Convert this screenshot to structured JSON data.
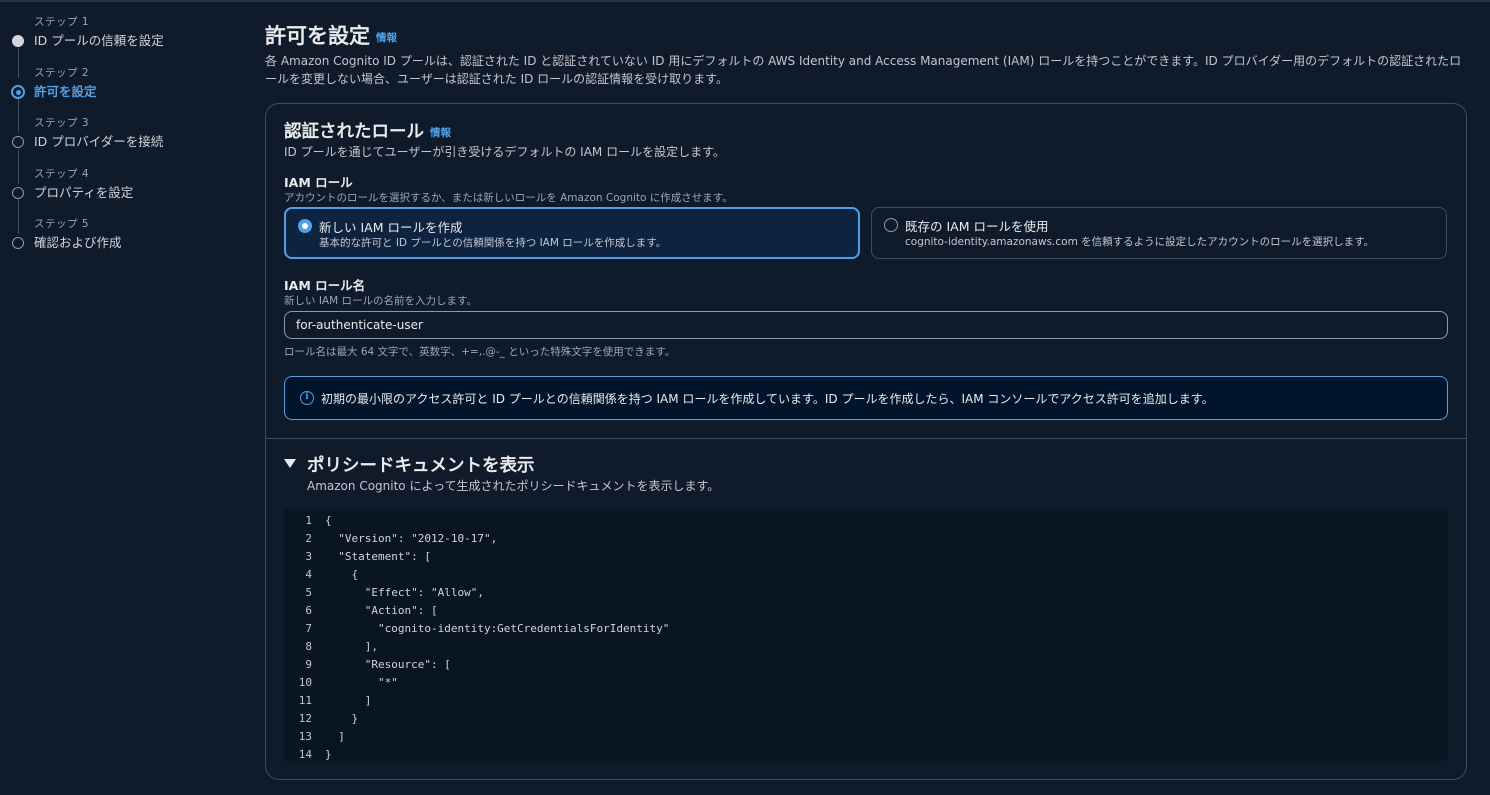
{
  "sidebar": {
    "steps": [
      {
        "label": "ステップ 1",
        "title": "ID プールの信頼を設定",
        "state": "completed"
      },
      {
        "label": "ステップ 2",
        "title": "許可を設定",
        "state": "active"
      },
      {
        "label": "ステップ 3",
        "title": "ID プロバイダーを接続",
        "state": "pending"
      },
      {
        "label": "ステップ 4",
        "title": "プロパティを設定",
        "state": "pending"
      },
      {
        "label": "ステップ 5",
        "title": "確認および作成",
        "state": "pending"
      }
    ]
  },
  "header": {
    "title": "許可を設定",
    "info": "情報",
    "description": "各 Amazon Cognito ID プールは、認証された ID と認証されていない ID 用にデフォルトの AWS Identity and Access Management (IAM) ロールを持つことができます。ID プロバイダー用のデフォルトの認証されたロールを変更しない場合、ユーザーは認証された ID ロールの認証情報を受け取ります。"
  },
  "auth_role": {
    "title": "認証されたロール",
    "info": "情報",
    "description": "ID プールを通じてユーザーが引き受けるデフォルトの IAM ロールを設定します。",
    "iam_role_label": "IAM ロール",
    "iam_role_desc": "アカウントのロールを選択するか、または新しいロールを Amazon Cognito に作成させます。",
    "options": [
      {
        "title": "新しい IAM ロールを作成",
        "desc": "基本的な許可と ID プールとの信頼関係を持つ IAM ロールを作成します。",
        "selected": true
      },
      {
        "title": "既存の IAM ロールを使用",
        "desc": "cognito-identity.amazonaws.com を信頼するように設定したアカウントのロールを選択します。",
        "selected": false
      }
    ],
    "role_name_label": "IAM ロール名",
    "role_name_desc": "新しい IAM ロールの名前を入力します。",
    "role_name_value": "for-authenticate-user",
    "role_name_constraint": "ロール名は最大 64 文字で、英数字、+=,.@-_ といった特殊文字を使用できます。",
    "alert_text": "初期の最小限のアクセス許可と ID プールとの信頼関係を持つ IAM ロールを作成しています。ID プールを作成したら、IAM コンソールでアクセス許可を追加します。"
  },
  "policy": {
    "title": "ポリシードキュメントを表示",
    "description": "Amazon Cognito によって生成されたポリシードキュメントを表示します。",
    "lines": [
      {
        "n": "1",
        "text": "{"
      },
      {
        "n": "2",
        "text": "  \"Version\": \"2012-10-17\","
      },
      {
        "n": "3",
        "text": "  \"Statement\": ["
      },
      {
        "n": "4",
        "text": "    {"
      },
      {
        "n": "5",
        "text": "      \"Effect\": \"Allow\","
      },
      {
        "n": "6",
        "text": "      \"Action\": ["
      },
      {
        "n": "7",
        "text": "        \"cognito-identity:GetCredentialsForIdentity\""
      },
      {
        "n": "8",
        "text": "      ],"
      },
      {
        "n": "9",
        "text": "      \"Resource\": ["
      },
      {
        "n": "10",
        "text": "        \"*\""
      },
      {
        "n": "11",
        "text": "      ]"
      },
      {
        "n": "12",
        "text": "    }"
      },
      {
        "n": "13",
        "text": "  ]"
      },
      {
        "n": "14",
        "text": "}"
      }
    ]
  },
  "colors": {
    "accent": "#539fe5",
    "background": "#0f1b2a",
    "border": "#414d5c"
  }
}
